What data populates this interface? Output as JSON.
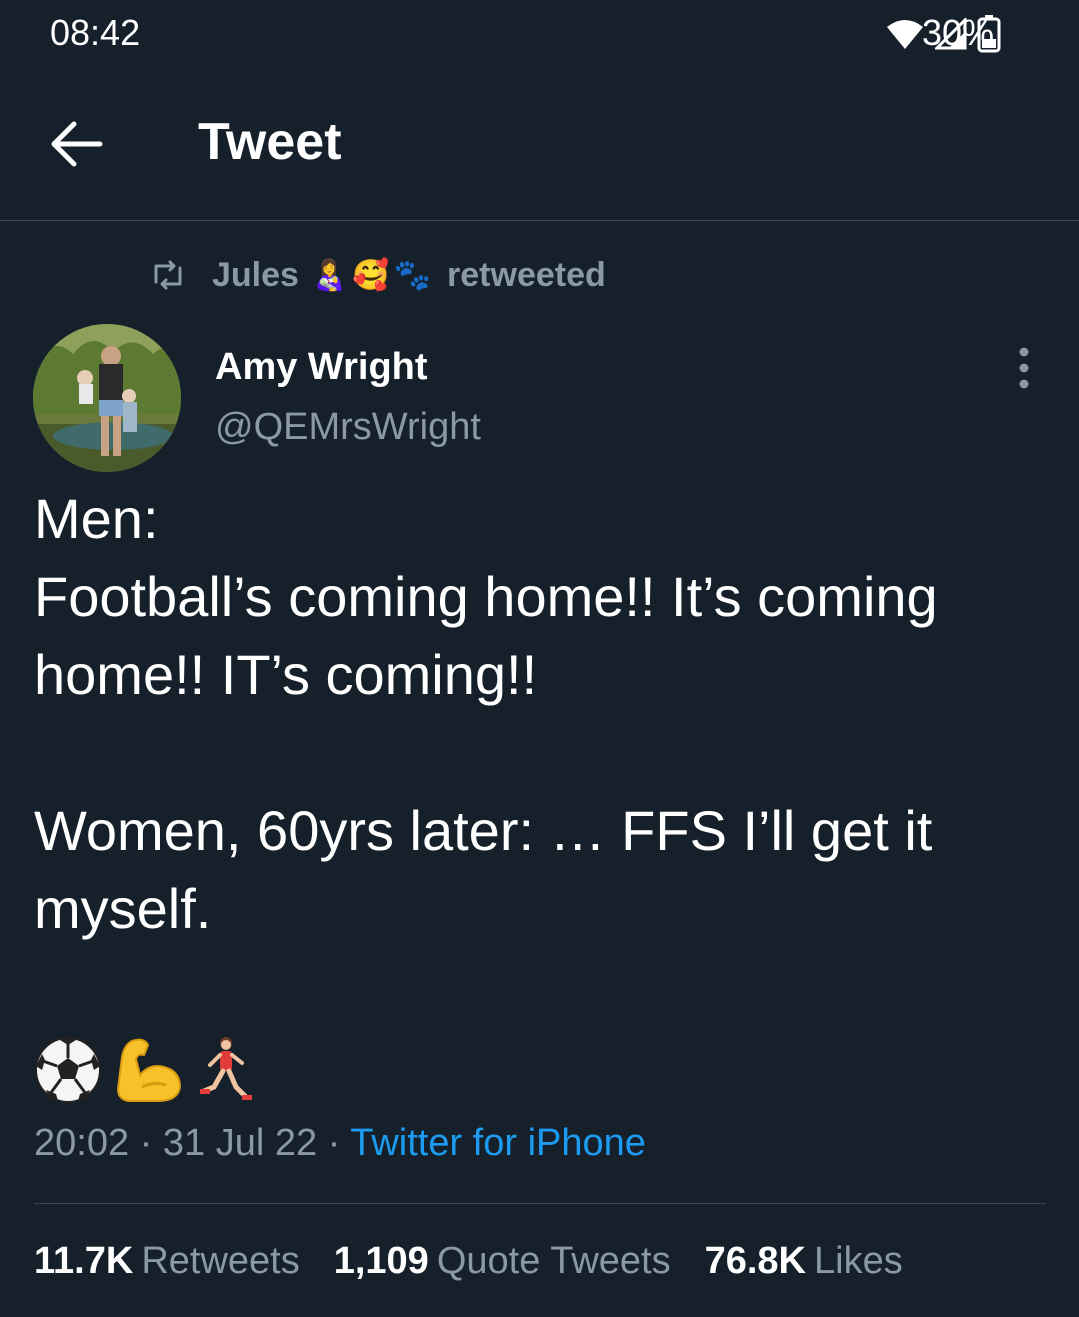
{
  "status_bar": {
    "time": "08:42",
    "battery": "30%",
    "icons": [
      "wifi-icon",
      "signal-icon",
      "battery-icon"
    ]
  },
  "header": {
    "title": "Tweet",
    "back_icon": "back-arrow-icon"
  },
  "retweet_context": {
    "user": "Jules",
    "emojis": [
      "👩‍🍼",
      "🥰",
      "🐾"
    ],
    "label": "retweeted"
  },
  "author": {
    "name": "Amy Wright",
    "handle": "@QEMrsWright"
  },
  "tweet": {
    "text": "Men:\nFootball’s coming home!! It’s coming home!! IT’s coming!!\n\nWomen, 60yrs later: … FFS I’ll get it myself.",
    "emojis": [
      "⚽",
      "💪",
      "🏃‍♀️"
    ]
  },
  "meta": {
    "time": "20:02",
    "separator": " · ",
    "date": "31 Jul 22",
    "source": "Twitter for iPhone"
  },
  "stats": {
    "retweets_count": "11.7K",
    "retweets_label": "Retweets",
    "quotes_count": "1,109",
    "quotes_label": "Quote Tweets",
    "likes_count": "76.8K",
    "likes_label": "Likes"
  },
  "colors": {
    "background": "#15202b",
    "secondary_text": "#8b98a5",
    "link": "#1d9bf0",
    "divider": "#38444d"
  }
}
